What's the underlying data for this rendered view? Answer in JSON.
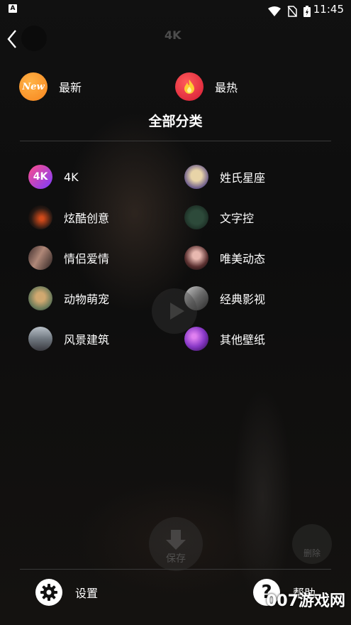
{
  "status_bar": {
    "time": "11:45"
  },
  "header": {
    "title": "4K"
  },
  "quick": [
    {
      "label": "最新",
      "badge": "New"
    },
    {
      "label": "最热"
    }
  ],
  "section_title": "全部分类",
  "categories": [
    {
      "label": "4K",
      "badge": "4K"
    },
    {
      "label": "姓氏星座"
    },
    {
      "label": "炫酷创意"
    },
    {
      "label": "文字控"
    },
    {
      "label": "情侣爱情"
    },
    {
      "label": "唯美动态"
    },
    {
      "label": "动物萌宠"
    },
    {
      "label": "经典影视"
    },
    {
      "label": "风景建筑"
    },
    {
      "label": "其他壁纸"
    }
  ],
  "background_buttons": {
    "save": "保存",
    "delete": "删除"
  },
  "bottom": {
    "settings": "设置",
    "help": "帮助"
  },
  "watermark": "007游戏网",
  "colors": {
    "accent_new": "#f7941d",
    "accent_hot": "#e0243c",
    "divider": "#3a3a3a"
  }
}
